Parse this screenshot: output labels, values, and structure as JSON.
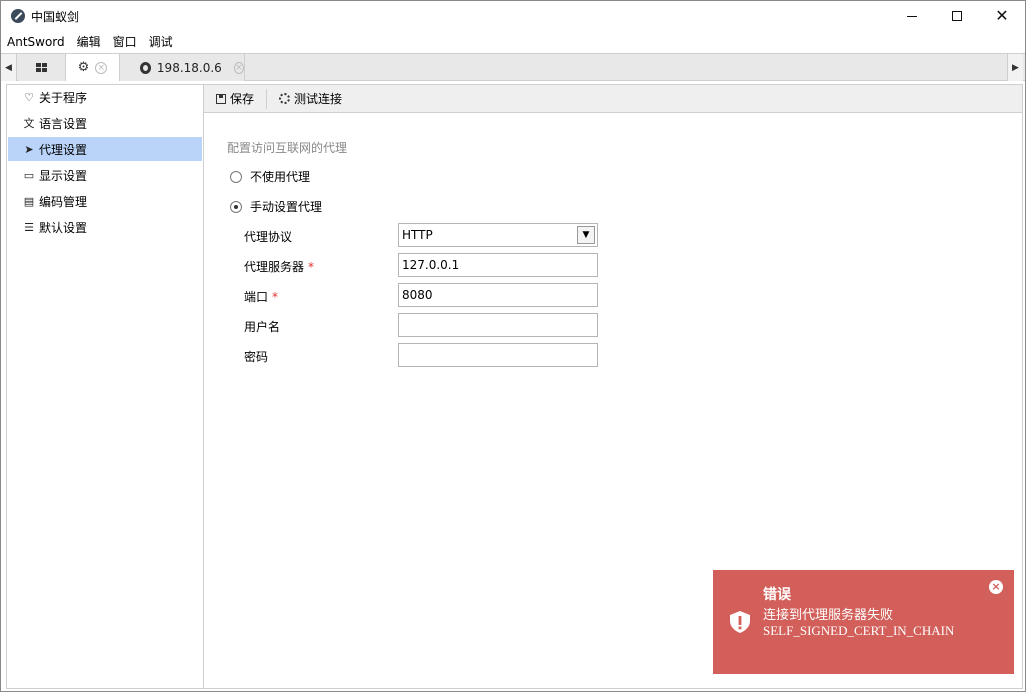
{
  "window": {
    "title": "中国蚁剑"
  },
  "menu": {
    "items": [
      "AntSword",
      "编辑",
      "窗口",
      "调试"
    ]
  },
  "tabs": {
    "ip_label": "198.18.0.6"
  },
  "sidebar": {
    "items": [
      {
        "label": "关于程序",
        "icon": "heart-icon"
      },
      {
        "label": "语言设置",
        "icon": "language-icon"
      },
      {
        "label": "代理设置",
        "icon": "paper-plane-icon",
        "active": true
      },
      {
        "label": "显示设置",
        "icon": "monitor-icon"
      },
      {
        "label": "编码管理",
        "icon": "file-code-icon"
      },
      {
        "label": "默认设置",
        "icon": "sliders-icon"
      }
    ]
  },
  "toolbar": {
    "save_label": "保存",
    "test_label": "测试连接"
  },
  "proxy": {
    "section_title": "配置访问互联网的代理",
    "no_proxy_label": "不使用代理",
    "manual_proxy_label": "手动设置代理",
    "selected": "manual",
    "protocol_label": "代理协议",
    "protocol_value": "HTTP",
    "server_label": "代理服务器",
    "server_value": "127.0.0.1",
    "port_label": "端口",
    "port_value": "8080",
    "username_label": "用户名",
    "username_value": "",
    "password_label": "密码",
    "password_value": "",
    "required_mark": "*"
  },
  "toast": {
    "title": "错误",
    "message": "连接到代理服务器失败",
    "error": "SELF_SIGNED_CERT_IN_CHAIN",
    "color": "#d25f5a"
  }
}
